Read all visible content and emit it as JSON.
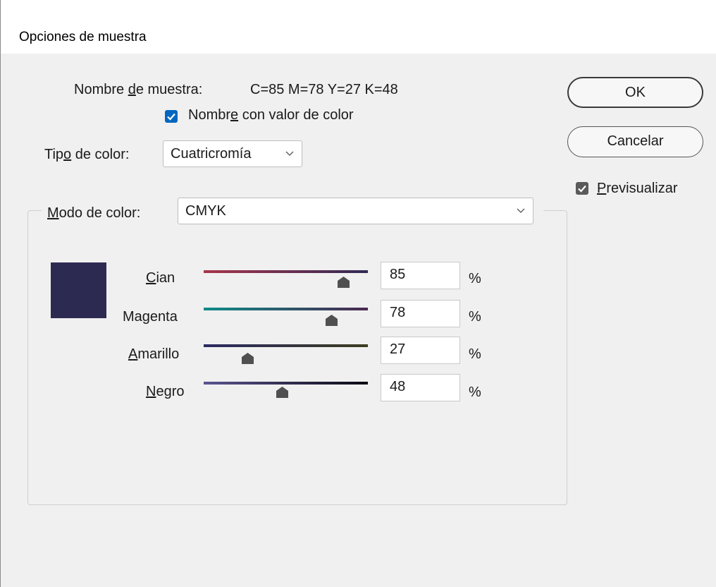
{
  "dialog": {
    "title": "Opciones de muestra",
    "swatch_name": {
      "label_before": "Nombre ",
      "label_mnemonic": "d",
      "label_after": "e muestra:",
      "value": "C=85 M=78 Y=27 K=48"
    },
    "name_with_color": {
      "checked": true,
      "label_before": "Nombr",
      "label_mnemonic": "e",
      "label_after": " con valor de color"
    },
    "color_type": {
      "label_before": "Tip",
      "label_mnemonic": "o",
      "label_after": " de color:",
      "selected": "Cuatricromía"
    },
    "color_mode": {
      "label_mnemonic": "M",
      "label_after": "odo de color:",
      "selected": "CMYK"
    },
    "buttons": {
      "ok": "OK",
      "cancel": "Cancelar"
    },
    "preview": {
      "checked": true,
      "label_mnemonic": "P",
      "label_after": "revisualizar"
    },
    "swatch_color": "#2d2a52",
    "channels": [
      {
        "name_before": "",
        "name_mnemonic": "C",
        "name_after": "ian",
        "value": "85",
        "unit": "%",
        "level": 0.85
      },
      {
        "name_before": "Ma",
        "name_mnemonic": "g",
        "name_after": "enta",
        "value": "78",
        "unit": "%",
        "level": 0.78
      },
      {
        "name_before": "",
        "name_mnemonic": "A",
        "name_after": "marillo",
        "value": "27",
        "unit": "%",
        "level": 0.27
      },
      {
        "name_before": "",
        "name_mnemonic": "N",
        "name_after": "egro",
        "value": "48",
        "unit": "%",
        "level": 0.48
      }
    ]
  }
}
